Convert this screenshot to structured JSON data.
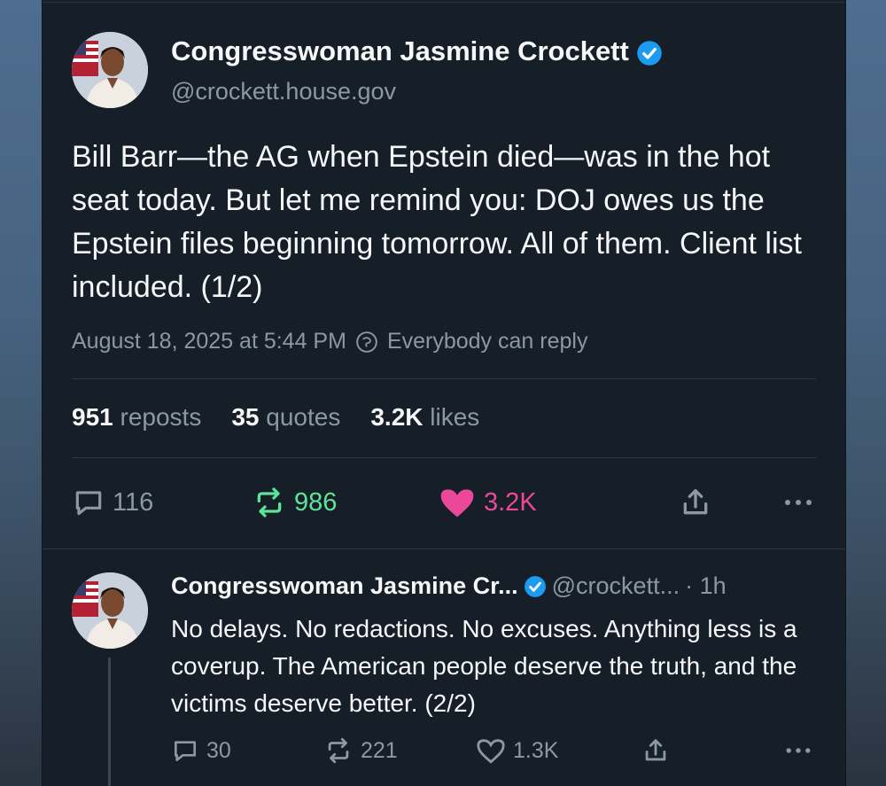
{
  "main_post": {
    "author_name": "Congresswoman Jasmine Crockett",
    "handle": "@crockett.house.gov",
    "text": "Bill Barr—the AG when Epstein died—was in the hot seat today. But let me remind you: DOJ owes us the Epstein files beginning tomorrow. All of them. Client list included. (1/2)",
    "timestamp": "August 18, 2025 at 5:44 PM",
    "reply_setting": "Everybody can reply",
    "stats": {
      "reposts_count": "951",
      "reposts_label": "reposts",
      "quotes_count": "35",
      "quotes_label": "quotes",
      "likes_count": "3.2K",
      "likes_label": "likes"
    },
    "actions": {
      "replies": "116",
      "reposts": "986",
      "likes": "3.2K"
    }
  },
  "reply_post": {
    "author_name": "Congresswoman Jasmine Cr...",
    "handle": "@crockett...",
    "time": "· 1h",
    "text": "No delays. No redactions. No excuses. Anything less is a coverup. The American people deserve the truth, and the victims deserve better. (2/2)",
    "actions": {
      "replies": "30",
      "reposts": "221",
      "likes": "1.3K"
    }
  },
  "colors": {
    "card_bg": "#161e27",
    "verified": "#1d9bf0",
    "repost_active": "#5ee39b",
    "like_active": "#ec4899",
    "muted": "#8b98a5"
  },
  "icons": [
    "verified-badge-icon",
    "reply-icon",
    "repost-icon",
    "heart-icon",
    "share-icon",
    "more-icon",
    "reply-setting-icon"
  ]
}
